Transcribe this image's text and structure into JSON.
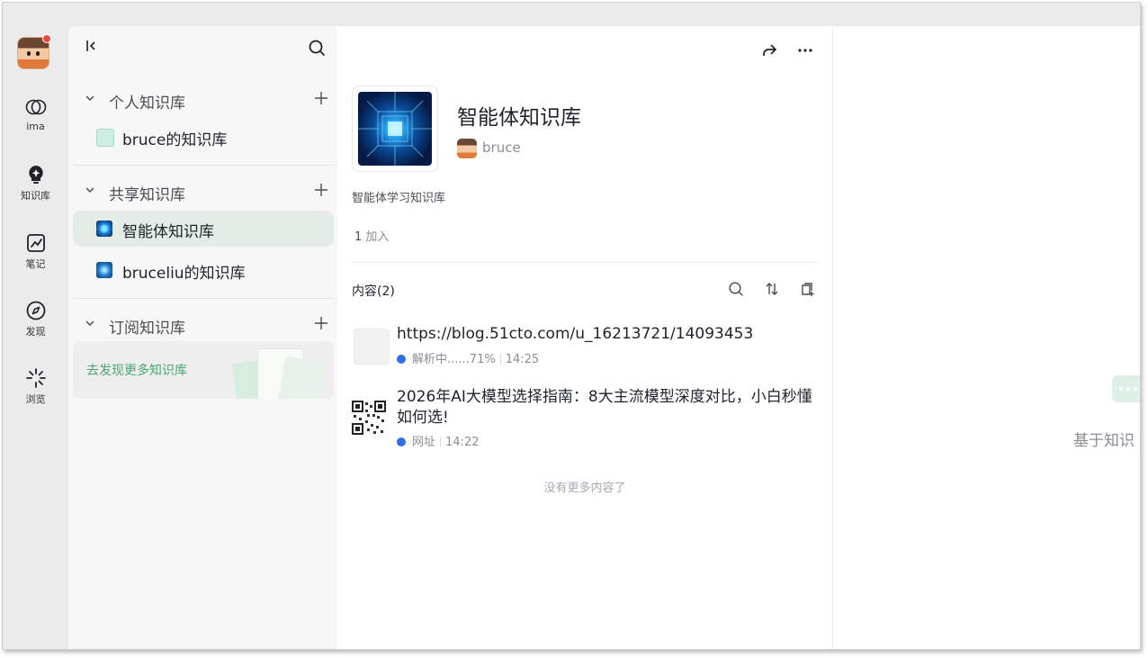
{
  "rail": {
    "items": [
      {
        "label": "ima",
        "icon": "ima-logo-icon"
      },
      {
        "label": "知识库",
        "icon": "bulb-icon"
      },
      {
        "label": "笔记",
        "icon": "note-icon"
      },
      {
        "label": "发现",
        "icon": "compass-icon"
      },
      {
        "label": "浏览",
        "icon": "browse-icon"
      }
    ]
  },
  "sidebar": {
    "sections": [
      {
        "title": "个人知识库",
        "items": [
          {
            "label": "bruce的知识库"
          }
        ]
      },
      {
        "title": "共享知识库",
        "items": [
          {
            "label": "智能体知识库",
            "active": true
          },
          {
            "label": "bruceliu的知识库"
          }
        ]
      },
      {
        "title": "订阅知识库",
        "items": []
      }
    ],
    "discover_label": "去发现更多知识库"
  },
  "detail": {
    "title": "智能体知识库",
    "owner": "bruce",
    "description": "智能体学习知识库",
    "joined_count": "1",
    "joined_label": "加入",
    "content_label": "内容(2)",
    "items": [
      {
        "title": "https://blog.51cto.com/u_16213721/14093453",
        "status": "解析中......71%",
        "time": "14:25"
      },
      {
        "title": "2026年AI大模型选择指南：8大主流模型深度对比，小白秒懂如何选!",
        "status": "网址",
        "time": "14:22"
      }
    ],
    "no_more": "没有更多内容了"
  },
  "right": {
    "hint": "基于知识"
  },
  "colors": {
    "accent_green": "#4aa672",
    "active_bg": "#e5ece5",
    "notify_red": "#f0463c",
    "link_blue": "#2f6ee6"
  }
}
